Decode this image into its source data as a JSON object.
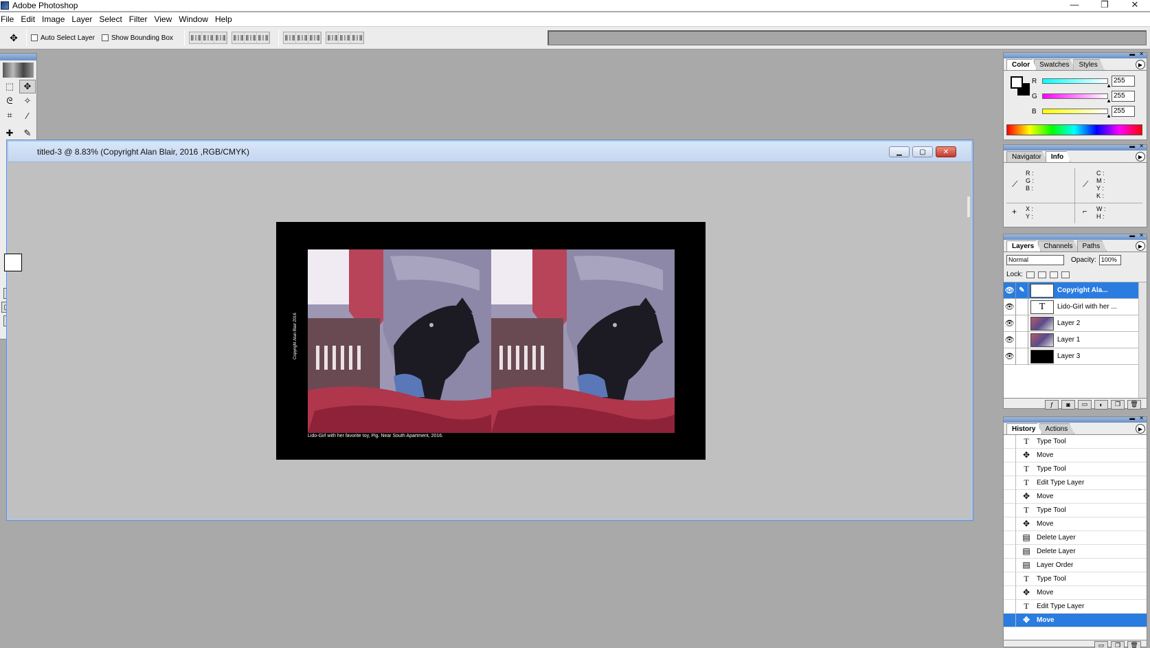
{
  "app": {
    "title": "Adobe Photoshop",
    "win_min": "—",
    "win_restore": "❐",
    "win_close": "✕"
  },
  "menu": [
    "File",
    "Edit",
    "Image",
    "Layer",
    "Select",
    "Filter",
    "View",
    "Window",
    "Help"
  ],
  "options": {
    "auto_select": "Auto Select Layer",
    "show_bounding": "Show Bounding Box"
  },
  "document": {
    "title": "titled-3 @ 8.83% (Copyright Alan Blair, 2016 ,RGB/CMYK)",
    "caption": "Lido-Girl with her favorite toy, Pig. Near South Apartment, 2016.",
    "vertical_copyright": "Copyright Alan Blair 2016"
  },
  "color_panel": {
    "tabs": [
      "Color",
      "Swatches",
      "Styles"
    ],
    "channels": [
      {
        "label": "R",
        "value": "255",
        "grad": "linear-gradient(90deg,#0ff,#fff)"
      },
      {
        "label": "G",
        "value": "255",
        "grad": "linear-gradient(90deg,#f0f,#fff)"
      },
      {
        "label": "B",
        "value": "255",
        "grad": "linear-gradient(90deg,#ff0,#fff)"
      }
    ]
  },
  "info_panel": {
    "tabs": [
      "Navigator",
      "Info"
    ],
    "rgb": "R :\nG :\nB :",
    "cmyk": "C :\nM :\nY :\nK :",
    "xy": "X :\nY :",
    "wh": "W :\nH :"
  },
  "layers_panel": {
    "tabs": [
      "Layers",
      "Channels",
      "Paths"
    ],
    "blend_mode": "Normal",
    "opacity_label": "Opacity:",
    "opacity": "100%",
    "lock_label": "Lock:",
    "layers": [
      {
        "name": "Copyright Ala...",
        "thumb": "T",
        "selected": true
      },
      {
        "name": "Lido-Girl with her ...",
        "thumb": "T",
        "selected": false
      },
      {
        "name": "Layer 2",
        "thumb": "",
        "selected": false
      },
      {
        "name": "Layer 1",
        "thumb": "",
        "selected": false
      },
      {
        "name": "Layer 3",
        "thumb": "",
        "selected": false
      }
    ]
  },
  "history_panel": {
    "tabs": [
      "History",
      "Actions"
    ],
    "items": [
      {
        "label": "Type Tool",
        "icon": "T"
      },
      {
        "label": "Move",
        "icon": "✥"
      },
      {
        "label": "Type Tool",
        "icon": "T"
      },
      {
        "label": "Edit Type Layer",
        "icon": "T"
      },
      {
        "label": "Move",
        "icon": "✥"
      },
      {
        "label": "Type Tool",
        "icon": "T"
      },
      {
        "label": "Move",
        "icon": "✥"
      },
      {
        "label": "Delete Layer",
        "icon": "▤"
      },
      {
        "label": "Delete Layer",
        "icon": "▤"
      },
      {
        "label": "Layer Order",
        "icon": "▤"
      },
      {
        "label": "Type Tool",
        "icon": "T"
      },
      {
        "label": "Move",
        "icon": "✥"
      },
      {
        "label": "Edit Type Layer",
        "icon": "T"
      },
      {
        "label": "Move",
        "icon": "✥"
      }
    ]
  },
  "colors": {
    "selection": "#2a7ce0",
    "window_border": "#a8c6ee"
  }
}
